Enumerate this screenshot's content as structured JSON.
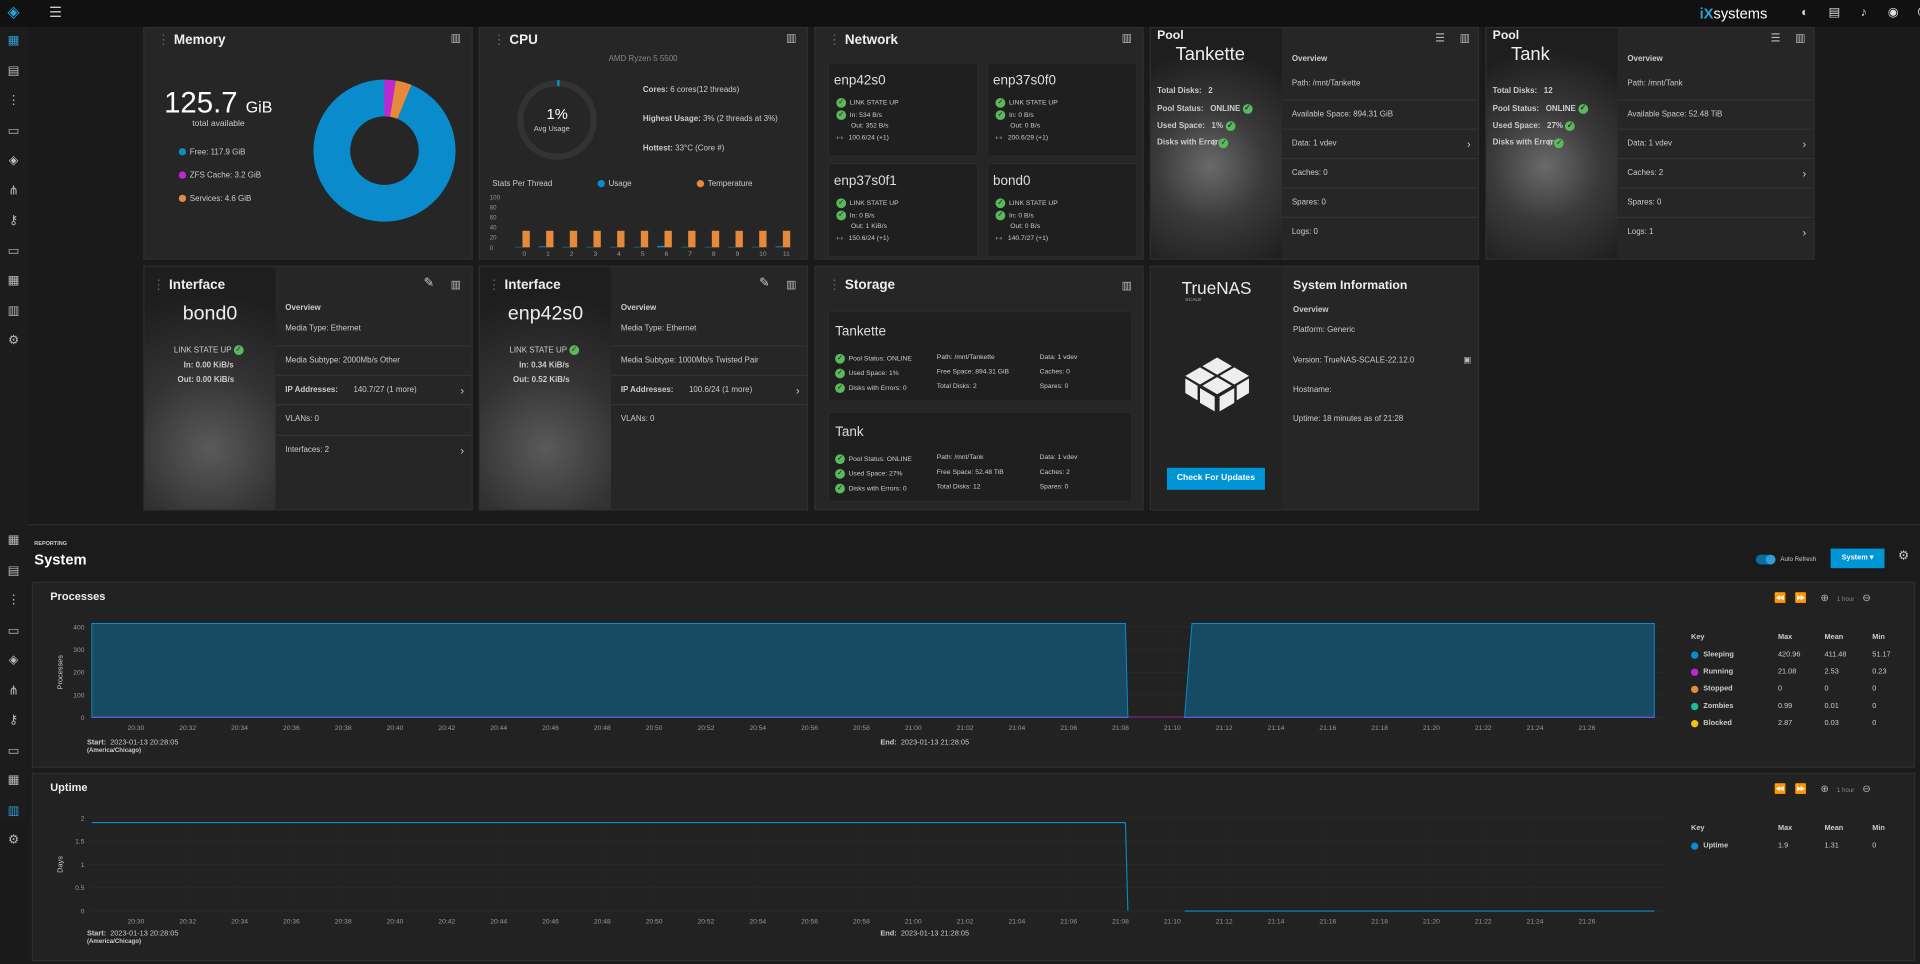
{
  "app": {
    "brand_ix": "iX",
    "brand_name": "systems"
  },
  "colors": {
    "accent": "#0095d5",
    "free": "#0a8bcc",
    "zfs": "#c026d3",
    "services": "#e5893b",
    "ok": "#5cb85c"
  },
  "memory": {
    "title": "Memory",
    "value": "125.7",
    "unit": "GiB",
    "sub": "total available",
    "free_label": "Free:",
    "free": "117.9 GiB",
    "zfs_label": "ZFS Cache:",
    "zfs": "3.2 GiB",
    "svc_label": "Services:",
    "svc": "4.6 GiB",
    "donut": [
      117.9,
      3.2,
      4.6
    ]
  },
  "cpu": {
    "title": "CPU",
    "model": "AMD Ryzen 5 5500",
    "avg": "1%",
    "avg_label": "Avg Usage",
    "cores_l": "Cores:",
    "cores": "6 cores(12 threads)",
    "high_l": "Highest Usage:",
    "high": "3%  (2 threads at 3%)",
    "hot_l": "Hottest:",
    "hot": "33°C  (Core #)",
    "stats": "Stats Per Thread",
    "usage": "Usage",
    "temp": "Temperature",
    "yticks": [
      "100",
      "80",
      "60",
      "40",
      "20",
      "0"
    ],
    "threads": [
      "0",
      "1",
      "2",
      "3",
      "4",
      "5",
      "6",
      "7",
      "8",
      "9",
      "10",
      "11"
    ],
    "temps": [
      33,
      33,
      33,
      33,
      33,
      33,
      33,
      33,
      33,
      33,
      33,
      33
    ],
    "usages": [
      1,
      2,
      1,
      1,
      1,
      1,
      3,
      1,
      1,
      1,
      1,
      2
    ]
  },
  "network": {
    "title": "Network",
    "ifaces": [
      {
        "name": "enp42s0",
        "state": "LINK STATE UP",
        "in": "In:  534 B/s",
        "out": "Out:  352 B/s",
        "ip": "100.6/24 (+1)"
      },
      {
        "name": "enp37s0f0",
        "state": "LINK STATE UP",
        "in": "In:  0 B/s",
        "out": "Out:  0 B/s",
        "ip": "200.6/29 (+1)"
      },
      {
        "name": "enp37s0f1",
        "state": "LINK STATE UP",
        "in": "In:  0 B/s",
        "out": "Out:  1 KiB/s",
        "ip": "150.6/24 (+1)"
      },
      {
        "name": "bond0",
        "state": "LINK STATE UP",
        "in": "In:  0 B/s",
        "out": "Out:  0 B/s",
        "ip": "140.7/27 (+1)"
      }
    ]
  },
  "pools": [
    {
      "title": "Pool",
      "name": "Tankette",
      "disks_l": "Total Disks:",
      "disks": "2",
      "status_l": "Pool Status:",
      "status": "ONLINE",
      "used_l": "Used Space:",
      "used": "1%",
      "err_l": "Disks with Errors:",
      "err": "0",
      "overview": "Overview",
      "path": "Path:  /mnt/Tankette",
      "avail": "Available Space:  894.31 GiB",
      "data": "Data:  1 vdev",
      "caches": "Caches:  0",
      "spares": "Spares:  0",
      "logs": "Logs:  0"
    },
    {
      "title": "Pool",
      "name": "Tank",
      "disks_l": "Total Disks:",
      "disks": "12",
      "status_l": "Pool Status:",
      "status": "ONLINE",
      "used_l": "Used Space:",
      "used": "27%",
      "err_l": "Disks with Errors:",
      "err": "0",
      "overview": "Overview",
      "path": "Path:  /mnt/Tank",
      "avail": "Available Space:  52.48 TiB",
      "data": "Data:  1 vdev",
      "caches": "Caches:  2",
      "spares": "Spares:  0",
      "logs": "Logs:  1"
    }
  ],
  "interfaces": [
    {
      "title": "Interface",
      "name": "bond0",
      "state": "LINK STATE UP",
      "in": "In:  0.00 KiB/s",
      "out": "Out:  0.00 KiB/s",
      "overview": "Overview",
      "media": "Media Type:  Ethernet",
      "subtype": "Media Subtype:  2000Mb/s Other",
      "ip": "IP Addresses:",
      "ipv": "140.7/27 (1 more)",
      "vlans": "VLANs:  0",
      "ifs": "Interfaces:  2"
    },
    {
      "title": "Interface",
      "name": "enp42s0",
      "state": "LINK STATE UP",
      "in": "In:  0.34 KiB/s",
      "out": "Out:  0.52 KiB/s",
      "overview": "Overview",
      "media": "Media Type:  Ethernet",
      "subtype": "Media Subtype:  1000Mb/s Twisted Pair",
      "ip": "IP Addresses:",
      "ipv": "100.6/24 (1 more)",
      "vlans": "VLANs:  0",
      "ifs": ""
    }
  ],
  "storage": {
    "title": "Storage",
    "pools": [
      {
        "name": "Tankette",
        "status": "Pool Status:  ONLINE",
        "used": "Used Space:  1%",
        "err": "Disks with Errors:  0",
        "path": "Path:  /mnt/Tankette",
        "free": "Free Space:  894.31 GiB",
        "disks": "Total Disks:  2",
        "data": "Data:  1 vdev",
        "caches": "Caches:  0",
        "spares": "Spares:  0"
      },
      {
        "name": "Tank",
        "status": "Pool Status:  ONLINE",
        "used": "Used Space:  27%",
        "err": "Disks with Errors:  0",
        "path": "Path:  /mnt/Tank",
        "free": "Free Space:  52.48 TiB",
        "disks": "Total Disks:  12",
        "data": "Data:  1 vdev",
        "caches": "Caches:  2",
        "spares": "Spares:  0"
      }
    ]
  },
  "sysinfo": {
    "logo": "TrueNAS",
    "logo_sub": "SCALE",
    "title": "System Information",
    "overview": "Overview",
    "platform": "Platform:  Generic",
    "version": "Version:  TrueNAS-SCALE-22.12.0",
    "hostname": "Hostname:",
    "uptime": "Uptime:  18 minutes as of 21:28",
    "button": "Check For Updates"
  },
  "report": {
    "crumb": "REPORTING",
    "title": "System",
    "auto": "Auto Refresh",
    "select": "System",
    "range": "1 hour",
    "key": "Key",
    "max": "Max",
    "mean": "Mean",
    "min": "Min",
    "start_l": "Start:",
    "end_l": "End:",
    "start": "2023-01-13 20:28:05",
    "tz": "(America/Chicago)",
    "end": "2023-01-13 21:28:05"
  },
  "chart_data": [
    {
      "type": "area",
      "title": "Processes",
      "ylabel": "Processes",
      "ylim": [
        0,
        400
      ],
      "yticks": [
        "400",
        "300",
        "200",
        "100",
        "0"
      ],
      "x": [
        "20:30",
        "20:32",
        "20:34",
        "20:36",
        "20:38",
        "20:40",
        "20:42",
        "20:44",
        "20:46",
        "20:48",
        "20:50",
        "20:52",
        "20:54",
        "20:56",
        "20:58",
        "21:00",
        "21:02",
        "21:04",
        "21:06",
        "21:08",
        "21:10",
        "21:12",
        "21:14",
        "21:16",
        "21:18",
        "21:20",
        "21:22",
        "21:24",
        "21:26"
      ],
      "gap": [
        "21:08",
        "21:10"
      ],
      "series": [
        {
          "name": "Sleeping",
          "color": "#0a8bcc",
          "max": "420.96",
          "mean": "411.48",
          "min": "51.17",
          "level": 415
        },
        {
          "name": "Running",
          "color": "#c026d3",
          "max": "21.08",
          "mean": "2.53",
          "min": "0.23",
          "level": 2
        },
        {
          "name": "Stopped",
          "color": "#e5893b",
          "max": "0",
          "mean": "0",
          "min": "0",
          "level": 0
        },
        {
          "name": "Zombies",
          "color": "#1abc9c",
          "max": "0.99",
          "mean": "0.01",
          "min": "0",
          "level": 0
        },
        {
          "name": "Blocked",
          "color": "#f1c40f",
          "max": "2.87",
          "mean": "0.03",
          "min": "0",
          "level": 0
        }
      ]
    },
    {
      "type": "line",
      "title": "Uptime",
      "ylabel": "Days",
      "ylim": [
        0,
        2
      ],
      "yticks": [
        "2",
        "1.5",
        "1",
        "0.5",
        "0"
      ],
      "x": [
        "20:30",
        "20:32",
        "20:34",
        "20:36",
        "20:38",
        "20:40",
        "20:42",
        "20:44",
        "20:46",
        "20:48",
        "20:50",
        "20:52",
        "20:54",
        "20:56",
        "20:58",
        "21:00",
        "21:02",
        "21:04",
        "21:06",
        "21:08",
        "21:10",
        "21:12",
        "21:14",
        "21:16",
        "21:18",
        "21:20",
        "21:22",
        "21:24",
        "21:26"
      ],
      "series": [
        {
          "name": "Uptime",
          "color": "#0a8bcc",
          "max": "1.9",
          "mean": "1.31",
          "min": "0",
          "before": 1.9,
          "after": 0
        }
      ]
    }
  ]
}
